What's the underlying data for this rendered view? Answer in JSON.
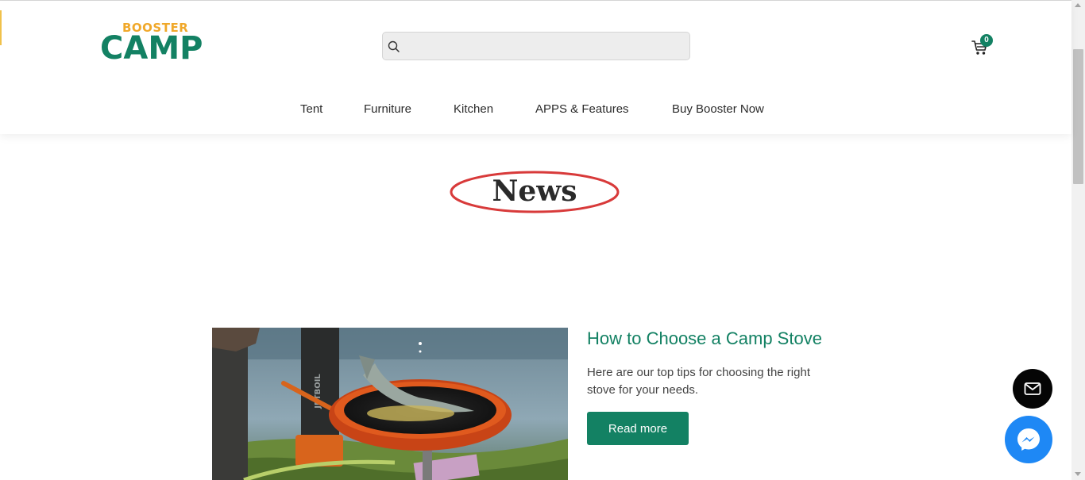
{
  "brand": {
    "logo_top": "BOOSTER",
    "logo_main": "CAMP",
    "colors": {
      "primary": "#138163",
      "accent": "#f0a82a"
    }
  },
  "search": {
    "icon": "search-icon",
    "value": "",
    "placeholder": ""
  },
  "cart": {
    "icon": "cart-icon",
    "count": "0"
  },
  "nav": {
    "items": [
      {
        "label": "Tent"
      },
      {
        "label": "Furniture"
      },
      {
        "label": "Kitchen"
      },
      {
        "label": "APPS & Features"
      },
      {
        "label": "Buy Booster Now"
      }
    ]
  },
  "page": {
    "title": "News",
    "title_highlight_color": "#d83a3a"
  },
  "article": {
    "title": "How to Choose a Camp Stove",
    "excerpt": "Here are our top tips for choosing the right stove for your needs.",
    "button_label": "Read more",
    "image_text": "JETBOIL"
  },
  "floating": {
    "mail_icon": "mail-icon",
    "messenger_icon": "messenger-icon",
    "messenger_color": "#1e88f5"
  }
}
